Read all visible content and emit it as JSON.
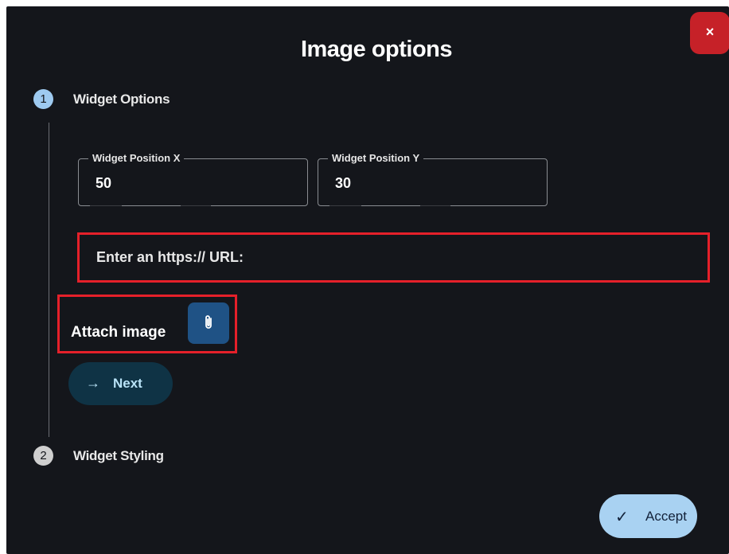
{
  "dialog": {
    "title": "Image options",
    "close_label": "×"
  },
  "steps": [
    {
      "number": "1",
      "label": "Widget Options",
      "state": "active"
    },
    {
      "number": "2",
      "label": "Widget Styling",
      "state": "inactive"
    }
  ],
  "fields": {
    "position_x": {
      "label": "Widget Position X",
      "value": "50"
    },
    "position_y": {
      "label": "Widget Position Y",
      "value": "30"
    }
  },
  "url": {
    "label": "Enter an https:// URL:"
  },
  "attach": {
    "label": "Attach image",
    "icon": "paperclip-icon"
  },
  "buttons": {
    "next_arrow": "→",
    "next_label": "Next",
    "accept_check": "✓",
    "accept_label": "Accept"
  },
  "colors": {
    "background": "#14161b",
    "close": "#c62128",
    "highlight": "#e5202a",
    "step_active": "#9ecaf0",
    "accept": "#a9d2f2",
    "attach_button": "#1f5285",
    "next_button": "#0f3345"
  }
}
